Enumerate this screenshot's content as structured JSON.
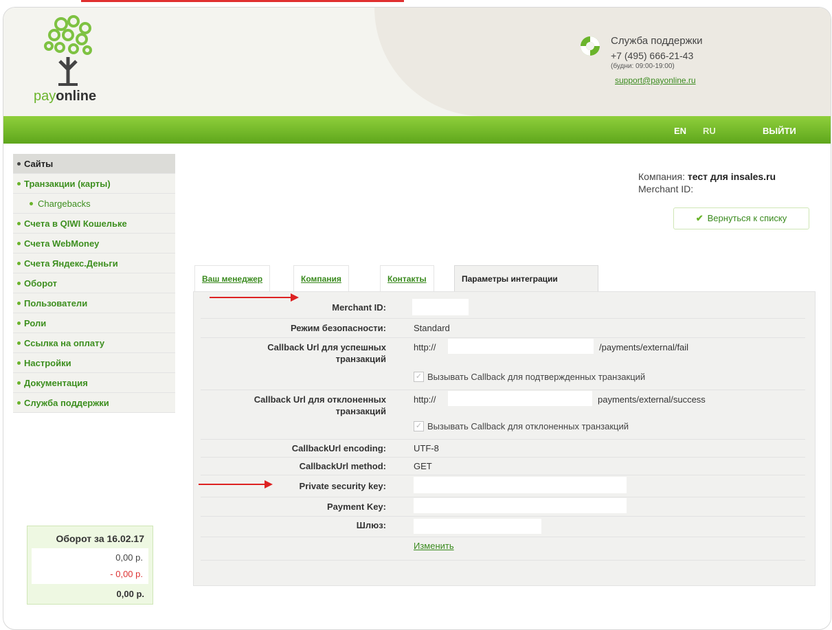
{
  "brand": {
    "logo_pay": "pay",
    "logo_online": "online"
  },
  "support": {
    "title": "Служба поддержки",
    "phone": "+7 (495) 666-21-43",
    "hours": "(будни: 09:00-19:00)",
    "email": "support@payonline.ru"
  },
  "topbar": {
    "lang_en": "EN",
    "lang_ru": "RU",
    "logout": "ВЫЙТИ"
  },
  "sidebar": {
    "items": [
      {
        "label": "Сайты",
        "active": true
      },
      {
        "label": "Транзакции (карты)"
      },
      {
        "label": "Chargebacks",
        "sub": true
      },
      {
        "label": "Счета в QIWI Кошельке"
      },
      {
        "label": "Счета WebMoney"
      },
      {
        "label": "Счета Яндекс.Деньги"
      },
      {
        "label": "Оборот"
      },
      {
        "label": "Пользователи"
      },
      {
        "label": "Роли"
      },
      {
        "label": "Ссылка на оплату"
      },
      {
        "label": "Настройки"
      },
      {
        "label": "Документация"
      },
      {
        "label": "Служба поддержки"
      }
    ]
  },
  "turnover": {
    "title": "Оборот за 16.02.17",
    "amount": "0,00 р.",
    "refund": "- 0,00 р.",
    "total": "0,00 р."
  },
  "company": {
    "label": "Компания:",
    "name": "тест для insales.ru",
    "merchant_label": "Merchant ID:"
  },
  "back_button": "Вернуться к списку",
  "tabs": {
    "manager": "Ваш менеджер",
    "company": "Компания",
    "contacts": "Контакты",
    "integration": "Параметры интеграции"
  },
  "form": {
    "merchant_id_label": "Merchant ID:",
    "security_mode_label": "Режим безопасности:",
    "security_mode_value": "Standard",
    "callback_success_label": "Callback Url для успешных транзакций",
    "callback_success_prefix": "http://",
    "callback_success_suffix": "/payments/external/fail",
    "callback_success_checkbox": "Вызывать Callback для подтвержденных транзакций",
    "callback_declined_label": "Callback Url для отклоненных транзакций",
    "callback_declined_prefix": "http://",
    "callback_declined_suffix": "payments/external/success",
    "callback_declined_checkbox": "Вызывать Callback для отклоненных транзакций",
    "encoding_label": "CallbackUrl encoding:",
    "encoding_value": "UTF-8",
    "method_label": "CallbackUrl method:",
    "method_value": "GET",
    "private_key_label": "Private security key:",
    "payment_key_label": "Payment Key:",
    "gateway_label": "Шлюз:",
    "change_link": "Изменить"
  }
}
